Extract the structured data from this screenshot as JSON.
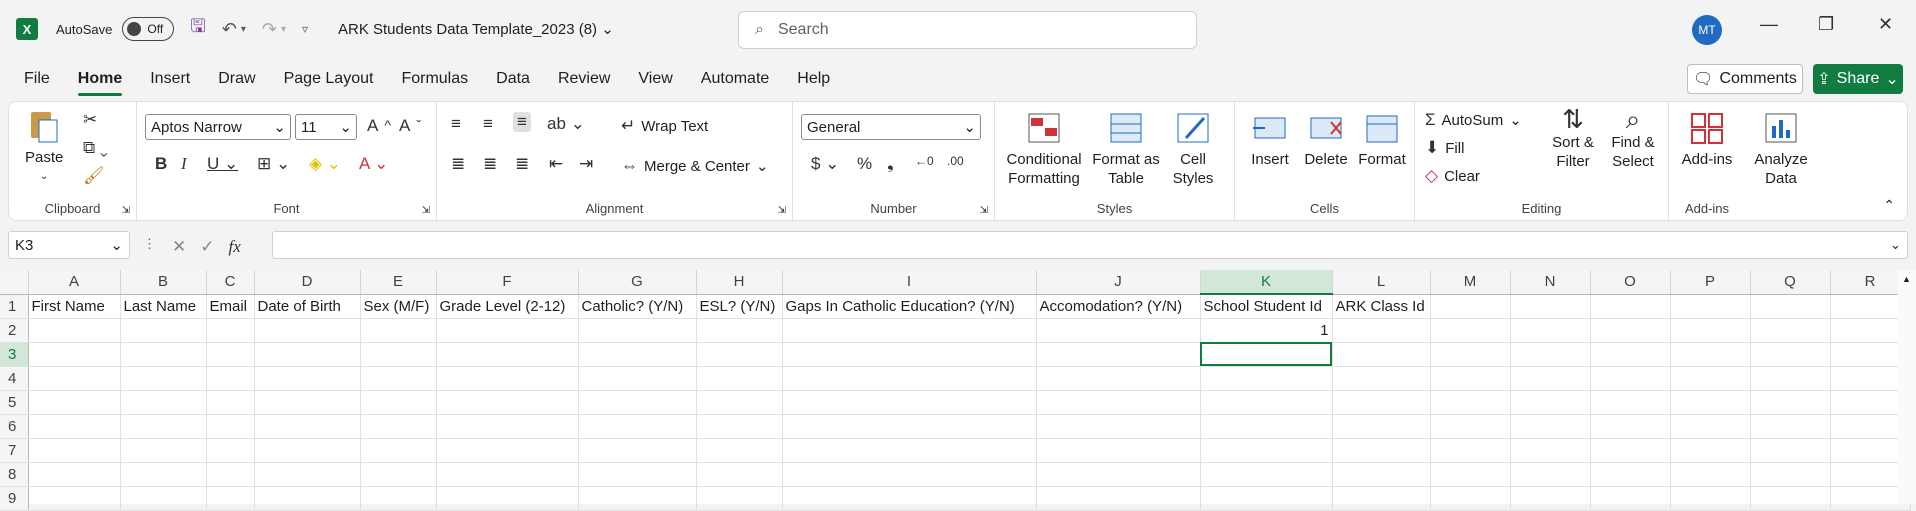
{
  "titlebar": {
    "autosave_label": "AutoSave",
    "autosave_state": "Off",
    "doc_title": "ARK Students Data Template_2023 (8)",
    "search_placeholder": "Search",
    "avatar_initials": "MT"
  },
  "menu": [
    "File",
    "Home",
    "Insert",
    "Draw",
    "Page Layout",
    "Formulas",
    "Data",
    "Review",
    "View",
    "Automate",
    "Help"
  ],
  "actions": {
    "comments": "Comments",
    "share": "Share"
  },
  "ribbon": {
    "clipboard": {
      "label": "Clipboard",
      "paste": "Paste"
    },
    "font": {
      "label": "Font",
      "name": "Aptos Narrow",
      "size": "11"
    },
    "alignment": {
      "label": "Alignment",
      "wrap": "Wrap Text",
      "merge": "Merge & Center"
    },
    "number": {
      "label": "Number",
      "format": "General"
    },
    "styles": {
      "label": "Styles",
      "conditional": "Conditional Formatting",
      "format_table": "Format as Table",
      "cell_styles": "Cell Styles"
    },
    "cells": {
      "label": "Cells",
      "insert": "Insert",
      "delete": "Delete",
      "format": "Format"
    },
    "editing": {
      "label": "Editing",
      "autosum": "AutoSum",
      "fill": "Fill",
      "clear": "Clear",
      "sort": "Sort & Filter",
      "find": "Find & Select"
    },
    "addins": {
      "label": "Add-ins",
      "addins": "Add-ins",
      "analyze": "Analyze Data"
    }
  },
  "formula": {
    "namebox": "K3",
    "fx": "fx",
    "content": ""
  },
  "sheet": {
    "columns": [
      "A",
      "B",
      "C",
      "D",
      "E",
      "F",
      "G",
      "H",
      "I",
      "J",
      "K",
      "L",
      "M",
      "N",
      "O",
      "P",
      "Q",
      "R"
    ],
    "selected_column": "K",
    "rows": [
      [
        "1",
        "First Name",
        "Last Name",
        "Email",
        "Date of Birth",
        "Sex (M/F)",
        "Grade Level (2-12)",
        "Catholic? (Y/N)",
        "ESL? (Y/N)",
        "Gaps In Catholic Education? (Y/N)",
        "Accomodation? (Y/N)",
        "School Student Id",
        "ARK Class Id",
        "",
        "",
        "",
        "",
        "",
        ""
      ],
      [
        "2",
        "",
        "",
        "",
        "",
        "",
        "",
        "",
        "",
        "",
        "",
        "1",
        "",
        "",
        "",
        "",
        "",
        "",
        ""
      ],
      [
        "3",
        "",
        "",
        "",
        "",
        "",
        "",
        "",
        "",
        "",
        "",
        "",
        "",
        "",
        "",
        "",
        "",
        "",
        ""
      ],
      [
        "4",
        "",
        "",
        "",
        "",
        "",
        "",
        "",
        "",
        "",
        "",
        "",
        "",
        "",
        "",
        "",
        "",
        "",
        ""
      ],
      [
        "5",
        "",
        "",
        "",
        "",
        "",
        "",
        "",
        "",
        "",
        "",
        "",
        "",
        "",
        "",
        "",
        "",
        "",
        ""
      ],
      [
        "6",
        "",
        "",
        "",
        "",
        "",
        "",
        "",
        "",
        "",
        "",
        "",
        "",
        "",
        "",
        "",
        "",
        "",
        ""
      ],
      [
        "7",
        "",
        "",
        "",
        "",
        "",
        "",
        "",
        "",
        "",
        "",
        "",
        "",
        "",
        "",
        "",
        "",
        "",
        ""
      ],
      [
        "8",
        "",
        "",
        "",
        "",
        "",
        "",
        "",
        "",
        "",
        "",
        "",
        "",
        "",
        "",
        "",
        "",
        "",
        ""
      ],
      [
        "9",
        "",
        "",
        "",
        "",
        "",
        "",
        "",
        "",
        "",
        "",
        "",
        "",
        "",
        "",
        "",
        "",
        "",
        ""
      ]
    ]
  }
}
